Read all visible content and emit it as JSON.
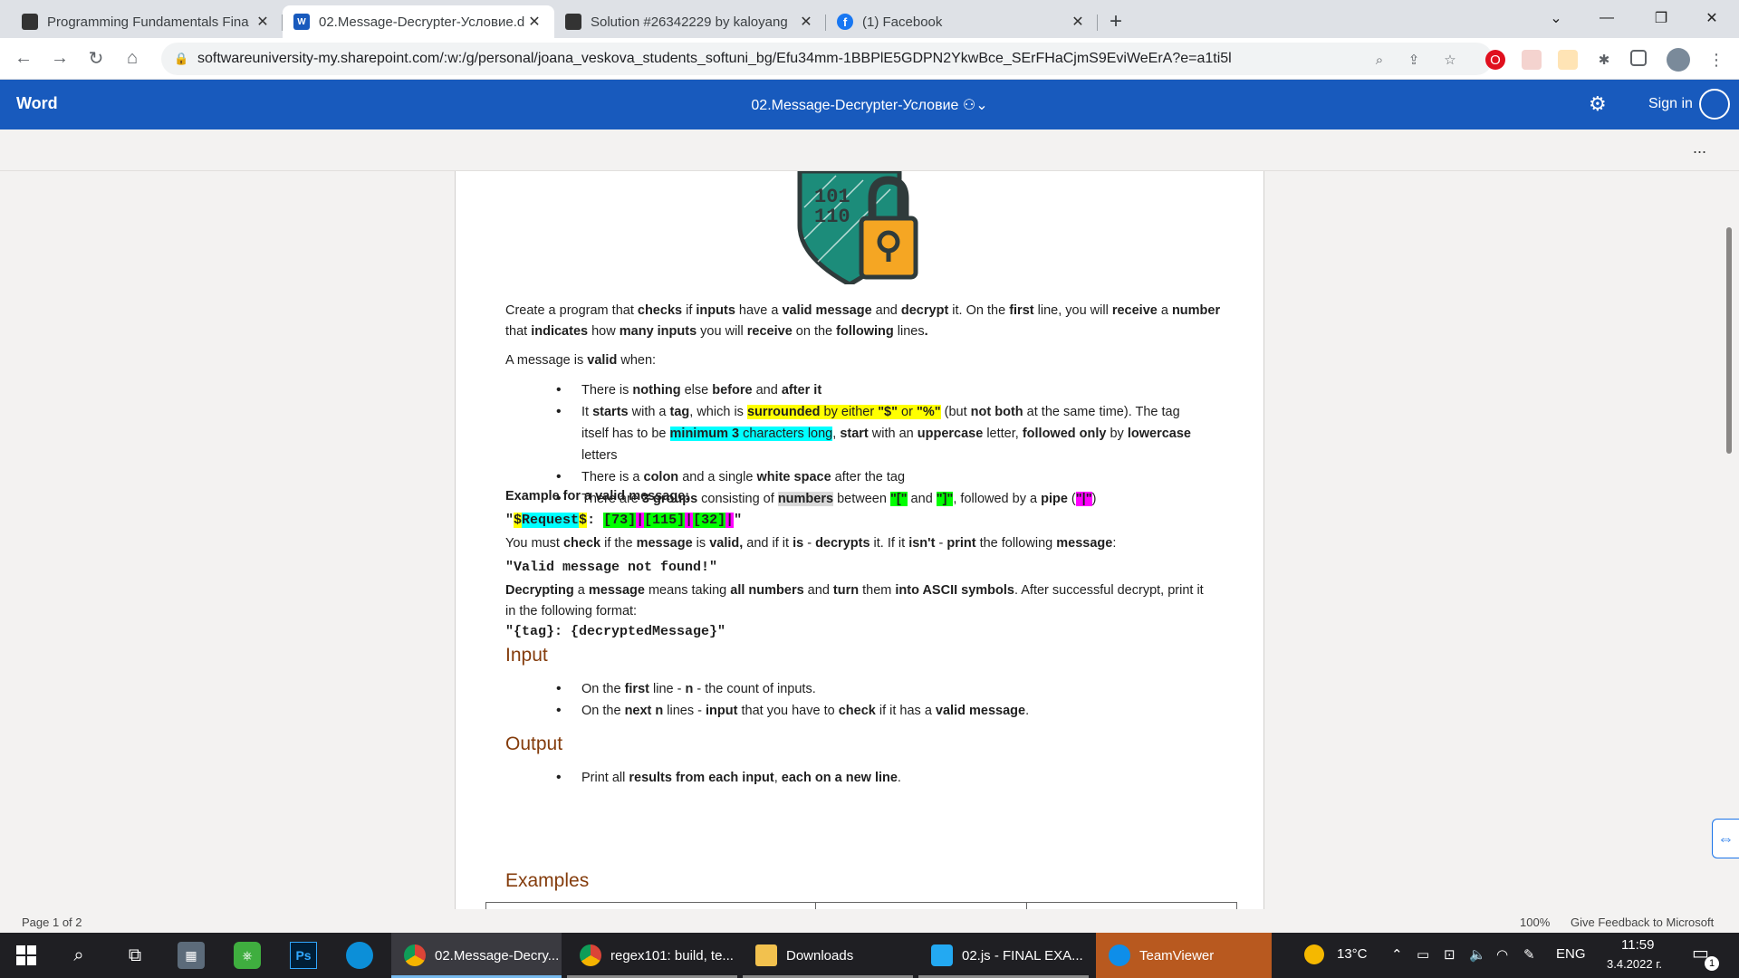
{
  "browser": {
    "tabs": [
      {
        "title": "Programming Fundamentals Fina",
        "active": false
      },
      {
        "title": "02.Message-Decrypter-Условие.d",
        "active": true
      },
      {
        "title": "Solution #26342229 by kaloyang",
        "active": false
      },
      {
        "title": "(1) Facebook",
        "active": false
      }
    ],
    "url": "softwareuniversity-my.sharepoint.com/:w:/g/personal/joana_veskova_students_softuni_bg/Efu34mm-1BBPlE5GDPN2YkwBce_SErFHaCjmS9EviWeErA?e=a1ti5l"
  },
  "word": {
    "app_name": "Word",
    "doc_title": "02.Message-Decrypter-Условие",
    "sign_in": "Sign in",
    "more": "..."
  },
  "doc": {
    "intro1_a": "Create a program that ",
    "intro1_b": "checks",
    "intro1_c": " if ",
    "intro1_d": "inputs",
    "intro1_e": " have a ",
    "intro1_f": "valid message",
    "intro1_g": " and ",
    "intro1_h": "decrypt",
    "intro1_i": " it. On the ",
    "intro1_j": "first",
    "intro1_k": " line, you will ",
    "intro1_l": "receive",
    "intro1_m": " a ",
    "intro1_n": "number",
    "intro2_a": "that ",
    "intro2_b": "indicates",
    "intro2_c": " how ",
    "intro2_d": "many inputs",
    "intro2_e": " you will ",
    "intro2_f": "receive",
    "intro2_g": " on the ",
    "intro2_h": "following",
    "intro2_i": " lines",
    "intro2_j": ".",
    "valid_a": "A message is ",
    "valid_b": "valid",
    "valid_c": " when:",
    "b1_a": "There is ",
    "b1_b": "nothing",
    "b1_c": " else ",
    "b1_d": "before",
    "b1_e": " and ",
    "b1_f": "after it",
    "b2_a": "It ",
    "b2_b": "starts",
    "b2_c": " with a ",
    "b2_d": "tag",
    "b2_e": ", which is ",
    "b2_f": "surrounded",
    "b2_g": " by either ",
    "b2_h": "\"$\"",
    "b2_i": " or ",
    "b2_j": "\"%\"",
    "b2_k": " (but ",
    "b2_l": "not both",
    "b2_m": " at the same time). The tag",
    "b2_n": "itself has to be ",
    "b2_o": "minimum 3",
    "b2_p": " characters long",
    "b2_q": ", ",
    "b2_r": "start",
    "b2_s": " with an ",
    "b2_t": "uppercase",
    "b2_u": " letter, ",
    "b2_v": "followed only",
    "b2_w": " by ",
    "b2_x": "lowercase",
    "b2_y": "letters",
    "b3_a": "There is a ",
    "b3_b": "colon",
    "b3_c": " and a single ",
    "b3_d": "white space",
    "b3_e": " after the tag",
    "b4_a": "There are ",
    "b4_b": "3 groups",
    "b4_c": " consisting of ",
    "b4_d": "numbers",
    "b4_e": " between ",
    "b4_f": "\"[\"",
    "b4_g": " and ",
    "b4_h": "\"]\"",
    "b4_i": ", followed by a ",
    "b4_j": "pipe",
    "b4_k": " (",
    "b4_l": "\"|\"",
    "b4_m": ")",
    "example_label": "Example for a valid message:",
    "ex_q1": "\"",
    "ex_d1": "$",
    "ex_tag": "Request",
    "ex_d2": "$",
    "ex_colon": ": ",
    "ex_g1": "[73]",
    "ex_p1": "|",
    "ex_g2": "[115]",
    "ex_p2": "|",
    "ex_g3": "[32]",
    "ex_p3": "|",
    "ex_q2": "\"",
    "check_a": "You must ",
    "check_b": "check",
    "check_c": " if the ",
    "check_d": "message",
    "check_e": " is ",
    "check_f": "valid,",
    "check_g": " and if it ",
    "check_h": "is",
    "check_i": " - ",
    "check_j": "decrypts",
    "check_k": " it. If it ",
    "check_l": "isn't",
    "check_m": " - ",
    "check_n": "print",
    "check_o": " the following ",
    "check_p": "message",
    "check_q": ":",
    "not_found": "\"Valid message not found!\"",
    "dec1_a": "Decrypting",
    "dec1_b": " a ",
    "dec1_c": "message",
    "dec1_d": " means taking ",
    "dec1_e": "all numbers",
    "dec1_f": " and ",
    "dec1_g": "turn",
    "dec1_h": " them ",
    "dec1_i": "into ASCII symbols",
    "dec1_j": ". After successful decrypt, print it",
    "dec2": "in the following format:",
    "format": "\"{tag}: {decryptedMessage}\"",
    "h_input": "Input",
    "in1_a": "On the ",
    "in1_b": "first",
    "in1_c": " line - ",
    "in1_d": "n",
    "in1_e": " - the count of inputs.",
    "in2_a": "On the ",
    "in2_b": "next n",
    "in2_c": " lines - ",
    "in2_d": "input",
    "in2_e": " that you have to ",
    "in2_f": "check",
    "in2_g": " if it has a ",
    "in2_h": "valid message",
    "in2_i": ".",
    "h_output": "Output",
    "out1_a": "Print all ",
    "out1_b": "results from each input",
    "out1_c": ", ",
    "out1_d": "each on a new line",
    "out1_e": ".",
    "h_examples": "Examples",
    "logo_bits1": "101",
    "logo_bits2": "110"
  },
  "status": {
    "page": "Page 1 of 2",
    "zoom": "100%",
    "feedback": "Give Feedback to Microsoft"
  },
  "taskbar": {
    "apps": [
      {
        "label": "02.Message-Decry..."
      },
      {
        "label": "regex101: build, te..."
      },
      {
        "label": "Downloads"
      },
      {
        "label": "02.js - FINAL EXA..."
      },
      {
        "label": "TeamViewer"
      }
    ],
    "temperature": "13°C",
    "lang": "ENG",
    "time": "11:59",
    "date": "3.4.2022 г.",
    "notif_count": "1"
  },
  "colors": {
    "word_blue": "#185abd",
    "heading": "#843c0c",
    "highlight_yellow": "#ffff00",
    "highlight_cyan": "#00ffff",
    "highlight_green": "#00ff00",
    "highlight_magenta": "#ff00ff"
  }
}
